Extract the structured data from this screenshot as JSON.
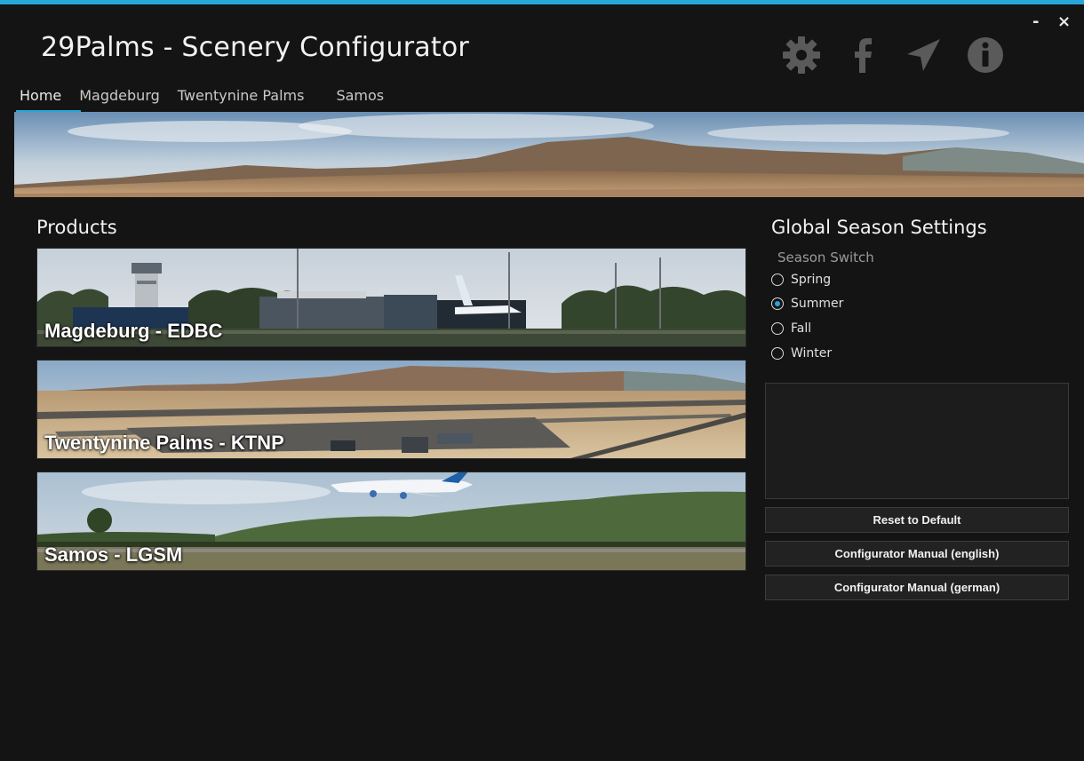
{
  "app": {
    "title": "29Palms - Scenery Configurator",
    "accent": "#27a6d8"
  },
  "window_controls": {
    "minimize": "-",
    "close": "×"
  },
  "header_icons": [
    "settings-gear-icon",
    "facebook-icon",
    "send-paper-plane-icon",
    "info-icon"
  ],
  "nav": {
    "tabs": [
      {
        "label": "Home",
        "active": true
      },
      {
        "label": "Magdeburg"
      },
      {
        "label": "Twentynine Palms"
      },
      {
        "label": "Samos"
      }
    ]
  },
  "products": {
    "heading": "Products",
    "items": [
      {
        "label": "Magdeburg - EDBC"
      },
      {
        "label": "Twentynine Palms - KTNP"
      },
      {
        "label": "Samos - LGSM"
      }
    ]
  },
  "season": {
    "heading": "Global Season Settings",
    "switch_label": "Season Switch",
    "options": [
      {
        "label": "Spring",
        "checked": false
      },
      {
        "label": "Summer",
        "checked": true
      },
      {
        "label": "Fall",
        "checked": false
      },
      {
        "label": "Winter",
        "checked": false
      }
    ]
  },
  "buttons": {
    "reset": "Reset to Default",
    "manual_en": "Configurator Manual (english)",
    "manual_de": "Configurator Manual (german)"
  }
}
